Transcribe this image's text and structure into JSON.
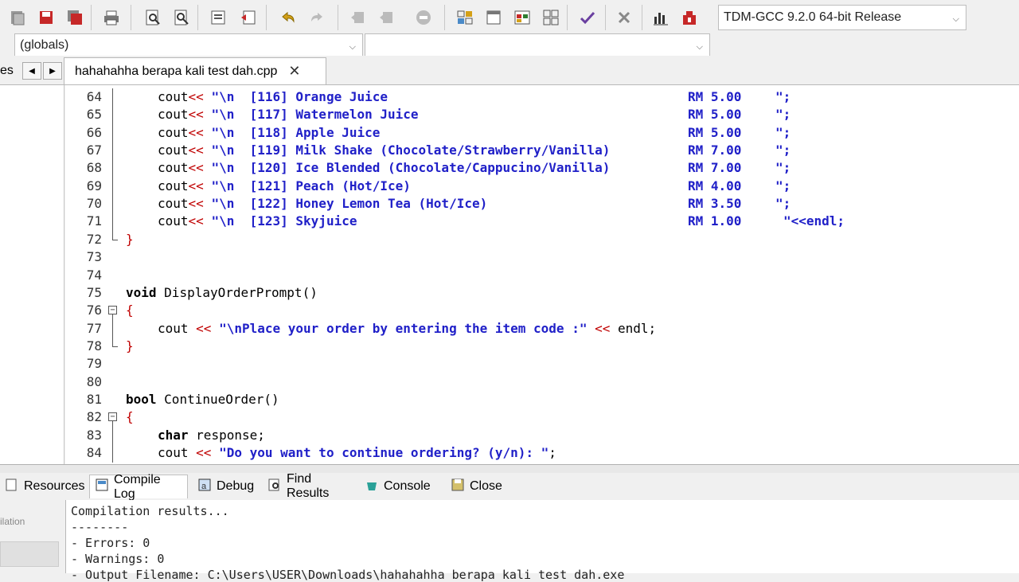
{
  "toolbar": {
    "icons": [
      "new-icon",
      "save-icon",
      "save-all-icon",
      "print-icon",
      "find-icon",
      "replace-icon",
      "indent-icon",
      "unindent-icon",
      "undo-icon",
      "redo-icon",
      "back-icon",
      "forward-icon",
      "bookmark-icon",
      "grid-icon",
      "window-icon",
      "chart-small-icon",
      "tiles-icon",
      "check-icon",
      "delete-icon",
      "bar-chart-icon",
      "debug-icon"
    ],
    "compiler_select": "TDM-GCC 9.2.0 64-bit Release"
  },
  "scope_bar": {
    "globals_select": "(globals)",
    "member_select": ""
  },
  "tabs": {
    "left_panel_label": "es",
    "file_tab_label": "hahahahha berapa kali test dah.cpp",
    "close_symbol": "✕"
  },
  "code": {
    "lines": [
      {
        "num": "64",
        "t": "menu",
        "code": "[116] Orange Juice",
        "price": "RM 5.00",
        "end": "\";"
      },
      {
        "num": "65",
        "t": "menu",
        "code": "[117] Watermelon Juice",
        "price": "RM 5.00",
        "end": "\";"
      },
      {
        "num": "66",
        "t": "menu",
        "code": "[118] Apple Juice",
        "price": "RM 5.00",
        "end": "\";"
      },
      {
        "num": "67",
        "t": "menu",
        "code": "[119] Milk Shake (Chocolate/Strawberry/Vanilla)",
        "price": "RM 7.00",
        "end": "\";"
      },
      {
        "num": "68",
        "t": "menu",
        "code": "[120] Ice Blended (Chocolate/Cappucino/Vanilla)",
        "price": "RM 7.00",
        "end": "\";"
      },
      {
        "num": "69",
        "t": "menu",
        "code": "[121] Peach (Hot/Ice)",
        "price": "RM 4.00",
        "end": "\";"
      },
      {
        "num": "70",
        "t": "menu",
        "code": "[122] Honey Lemon Tea (Hot/Ice)",
        "price": "RM 3.50",
        "end": "\";"
      },
      {
        "num": "71",
        "t": "menu",
        "code": "[123] Skyjuice",
        "price": "RM 1.00",
        "end": "\"<<endl;"
      },
      {
        "num": "72",
        "t": "close"
      },
      {
        "num": "73",
        "t": "blank"
      },
      {
        "num": "74",
        "t": "blank"
      },
      {
        "num": "75",
        "t": "func",
        "kw": "void",
        "name": "DisplayOrderPrompt()"
      },
      {
        "num": "76",
        "t": "open"
      },
      {
        "num": "77",
        "t": "cout",
        "str": "\"\\nPlace your order by entering the item code :\"",
        "tail": "endl;"
      },
      {
        "num": "78",
        "t": "close"
      },
      {
        "num": "79",
        "t": "blank"
      },
      {
        "num": "80",
        "t": "blank"
      },
      {
        "num": "81",
        "t": "func",
        "kw": "bool",
        "name": "ContinueOrder()"
      },
      {
        "num": "82",
        "t": "open"
      },
      {
        "num": "83",
        "t": "decl",
        "kw": "char",
        "name": "response;"
      },
      {
        "num": "84",
        "t": "cout",
        "str": "\"Do you want to continue ordering? (y/n): \"",
        "tail": ""
      }
    ]
  },
  "bottom_panel": {
    "tabs": [
      {
        "label": "Resources",
        "icon": "resources-icon"
      },
      {
        "label": "Compile Log",
        "icon": "compile-log-icon"
      },
      {
        "label": "Debug",
        "icon": "debug-tab-icon"
      },
      {
        "label": "Find Results",
        "icon": "find-results-icon"
      },
      {
        "label": "Console",
        "icon": "console-icon"
      },
      {
        "label": "Close",
        "icon": "close-tab-icon"
      }
    ],
    "left_label": "ilation",
    "log_lines": [
      "Compilation results...",
      "--------",
      "- Errors: 0",
      "- Warnings: 0",
      "- Output Filename: C:\\Users\\USER\\Downloads\\hahahahha berapa kali test dah.exe"
    ]
  },
  "colors": {
    "string": "#2020c8",
    "operator": "#c00000",
    "brace": "#c00000"
  }
}
